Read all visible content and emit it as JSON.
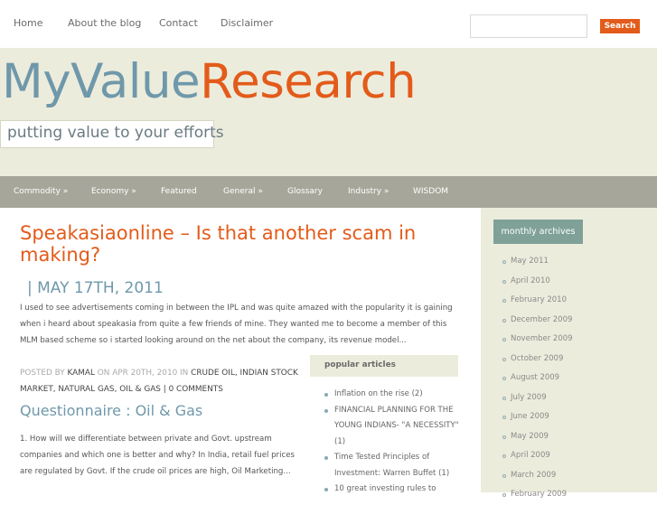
{
  "nav": {
    "home": "Home",
    "about": "About the blog",
    "contact": "Contact",
    "disclaimer": "Disclaimer"
  },
  "search": {
    "placeholder": "",
    "button": "Search"
  },
  "logo": {
    "part1": "MyValue",
    "part2": "Research"
  },
  "tagline": "putting value to your efforts",
  "categories": {
    "commodity": "Commodity »",
    "economy": "Economy »",
    "featured": "Featured",
    "general": "General »",
    "glossary": "Glossary",
    "industry": "Industry »",
    "wisdom": "WISDOM"
  },
  "post1": {
    "title": "Speakasiaonline – Is that another scam in making?",
    "date": "| MAY 17TH, 2011",
    "excerpt": "I used to see advertisements coming in between the IPL and was quite amazed with the popularity it is gaining when i heard about speakasia from quite a few friends of mine. They wanted me to become a member of this MLM based scheme so i started looking around on the net about the company, its revenue model...",
    "meta": {
      "posted_by": "POSTED BY",
      "author": "KAMAL",
      "on": "ON APR 20TH, 2010 IN",
      "cat1": "CRUDE OIL",
      "cat2": "INDIAN STOCK MARKET",
      "cat3": "NATURAL GAS",
      "cat4": "OIL & GAS",
      "comments": "0 COMMENTS"
    }
  },
  "post2": {
    "title": "Questionnaire : Oil & Gas",
    "excerpt": "1. How will we differentiate between private and Govt. upstream companies and which one is better and why? In India, retail fuel prices are regulated by Govt. If the crude oil prices are high, Oil Marketing..."
  },
  "popular": {
    "heading": "popular articles",
    "items": [
      "Inflation on the rise (2)",
      "FINANCIAL PLANNING FOR THE YOUNG INDIANS- \"A NECESSITY\" (1)",
      "Time Tested Principles of Investment: Warren Buffet (1)",
      "10 great investing rules to"
    ]
  },
  "archives": {
    "heading": "monthly archives",
    "items": [
      "May 2011",
      "April 2010",
      "February 2010",
      "December 2009",
      "November 2009",
      "October 2009",
      "August 2009",
      "July 2009",
      "June 2009",
      "May 2009",
      "April 2009",
      "March 2009",
      "February 2009"
    ]
  }
}
